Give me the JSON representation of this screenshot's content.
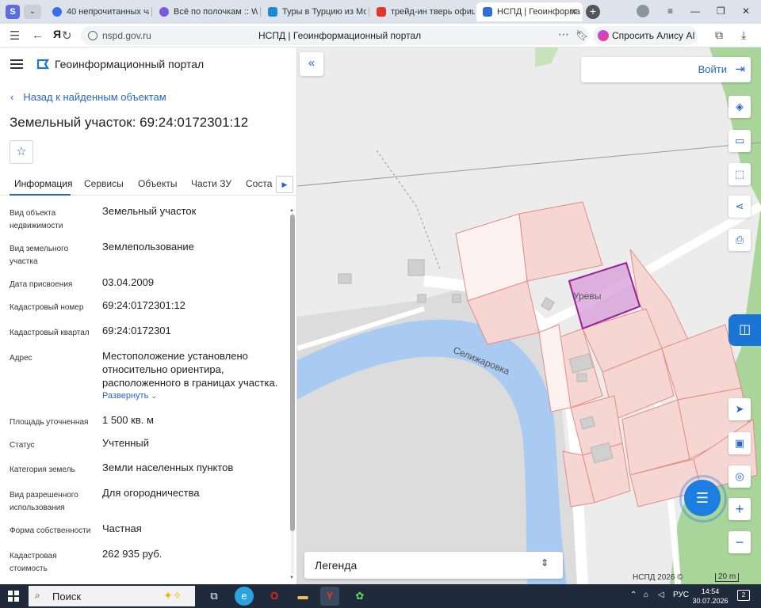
{
  "browser": {
    "profile_letter": "S",
    "tabs": [
      {
        "title": "40 непрочитанных ча",
        "color": "#3a6df0"
      },
      {
        "title": "Всё по полочкам :: Wik",
        "color": "#7a59e0"
      },
      {
        "title": "Туры в Турцию из Мос",
        "color": "#1b8ad6"
      },
      {
        "title": "трейд-ин тверь офици",
        "color": "#e8352a"
      },
      {
        "title": "НСПД | Геоинформа",
        "color": "#2d6fd8"
      }
    ],
    "url_domain": "nspd.gov.ru",
    "page_title": "НСПД | Геоинформационный портал",
    "alice_label": "Спросить Алису AI"
  },
  "panel": {
    "app_title": "Геоинформационный портал",
    "back_link": "Назад к найденным объектам",
    "object_title": "Земельный участок: 69:24:0172301:12",
    "tabs": [
      "Информация",
      "Сервисы",
      "Объекты",
      "Части ЗУ",
      "Состав"
    ],
    "rows": [
      {
        "label": "Вид объекта недвижимости",
        "value": "Земельный участок"
      },
      {
        "label": "Вид земельного участка",
        "value": "Землепользование"
      },
      {
        "label": "Дата присвоения",
        "value": "03.04.2009"
      },
      {
        "label": "Кадастровый номер",
        "value": "69:24:0172301:12"
      },
      {
        "label": "Кадастровый квартал",
        "value": "69:24:0172301"
      },
      {
        "label": "Адрес",
        "value": "Местоположение установлено относительно ориентира, расположенного в границах участка."
      },
      {
        "label": "Площадь уточненная",
        "value": "1 500 кв. м"
      },
      {
        "label": "Статус",
        "value": "Учтенный"
      },
      {
        "label": "Категория земель",
        "value": "Земли населенных пунктов"
      },
      {
        "label": "Вид разрешенного использования",
        "value": "Для огородничества"
      },
      {
        "label": "Форма собственности",
        "value": "Частная"
      },
      {
        "label": "Кадастровая стоимость",
        "value": "262 935 руб."
      }
    ],
    "expand_label": "Развернуть"
  },
  "map": {
    "login_label": "Войти",
    "river_label": "Селижаровка",
    "place_label": "Уревы",
    "legend_label": "Легенда",
    "copyright": "НСПД 2026 ©",
    "scale": "20 m",
    "colors": {
      "parcel_fill": "#f6d6d2",
      "parcel_stroke": "#e58c82",
      "selected_fill": "#d89bd8",
      "selected_stroke": "#9b1f9b",
      "river": "#a9cbf2",
      "green": "#a9d49a"
    }
  },
  "taskbar": {
    "search_label": "Поиск",
    "lang": "РУС",
    "time": "14:54",
    "date": "30.07.2026",
    "notifications": "2"
  }
}
